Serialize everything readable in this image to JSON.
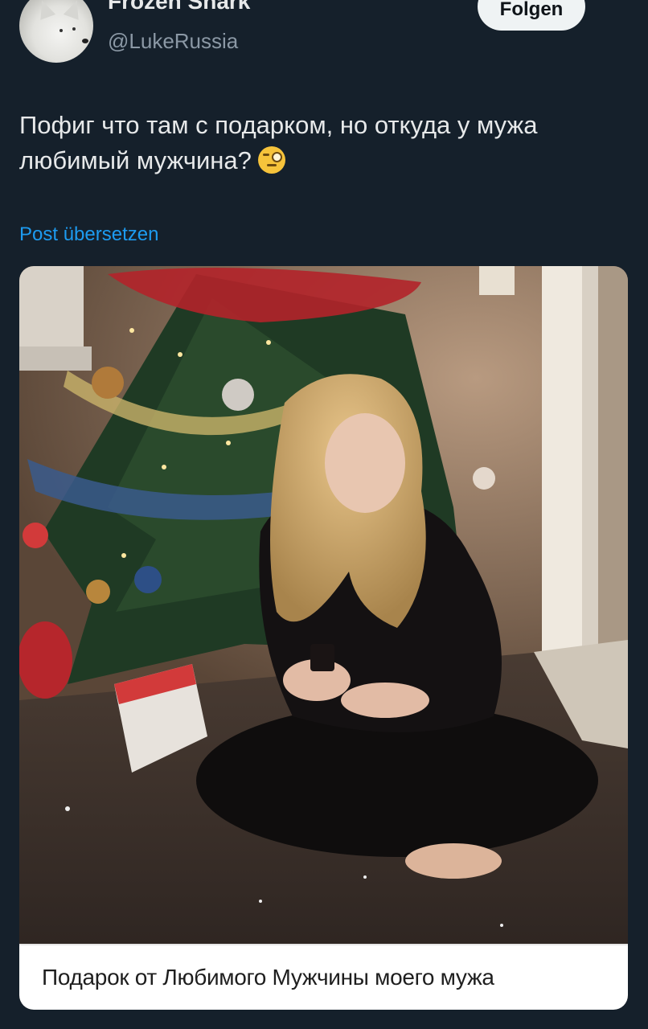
{
  "header": {
    "display_name": "Frozen Shark",
    "handle": "@LukeRussia",
    "follow_label": "Folgen"
  },
  "tweet": {
    "text": "Пофиг что там с подарком, но откуда у мужа любимый мужчина?",
    "emoji": "face-with-monocle-icon",
    "translate_label": "Post übersetzen"
  },
  "media": {
    "caption": "Подарок от Любимого Мужчины моего мужа"
  },
  "colors": {
    "background": "#15202b",
    "text_primary": "#e7e9ea",
    "text_secondary": "#8b98a5",
    "link": "#1d9bf0"
  }
}
